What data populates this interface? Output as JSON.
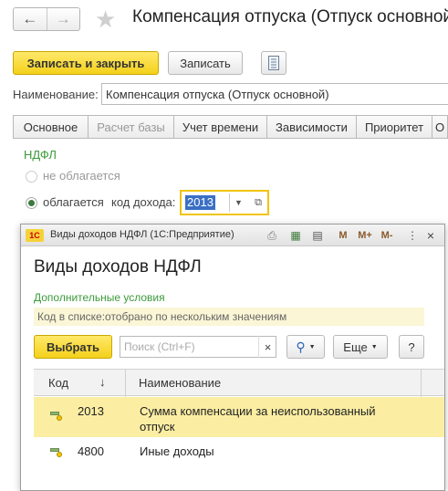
{
  "header": {
    "title": "Компенсация отпуска (Отпуск основной)",
    "back_icon": "arrow-left-icon",
    "forward_icon": "arrow-right-icon",
    "favorite_icon": "star-icon"
  },
  "toolbar": {
    "save_close_label": "Записать и закрыть",
    "save_label": "Записать",
    "report_icon": "document-icon"
  },
  "fields": {
    "name_label": "Наименование:",
    "name_value": "Компенсация отпуска (Отпуск основной)"
  },
  "tabs": [
    {
      "label": "Основное"
    },
    {
      "label": "Расчет базы"
    },
    {
      "label": "Учет времени"
    },
    {
      "label": "Зависимости"
    },
    {
      "label": "Приоритет"
    },
    {
      "label": "О"
    }
  ],
  "ndfl": {
    "group_title": "НДФЛ",
    "option_not_taxed": "не облагается",
    "option_taxed": "облагается",
    "income_code_label": "код дохода:",
    "income_code_value": "2013"
  },
  "dialog": {
    "window_title": "Виды доходов НДФЛ  (1С:Предприятие)",
    "window_buttons": [
      "M",
      "M+",
      "M-"
    ],
    "heading": "Виды доходов НДФЛ",
    "extra_conditions": "Дополнительные условия",
    "filter_info": "Код в списке:отобрано по нескольким значениям",
    "select_button": "Выбрать",
    "search_placeholder": "Поиск (Ctrl+F)",
    "clear_search": "×",
    "more_button": "Еще",
    "help_button": "?",
    "columns": {
      "code": "Код",
      "sort_arrow": "↓",
      "name": "Наименование"
    },
    "rows": [
      {
        "code": "2013",
        "name_line1": "Сумма компенсации за неиспользованный",
        "name_line2": "отпуск",
        "selected": true
      },
      {
        "code": "4800",
        "name_line1": "Иные доходы",
        "name_line2": "",
        "selected": false
      }
    ]
  },
  "colors": {
    "accent_yellow": "#f4d11b",
    "group_green": "#3c9a3c",
    "selected_row": "#fbeea3"
  }
}
